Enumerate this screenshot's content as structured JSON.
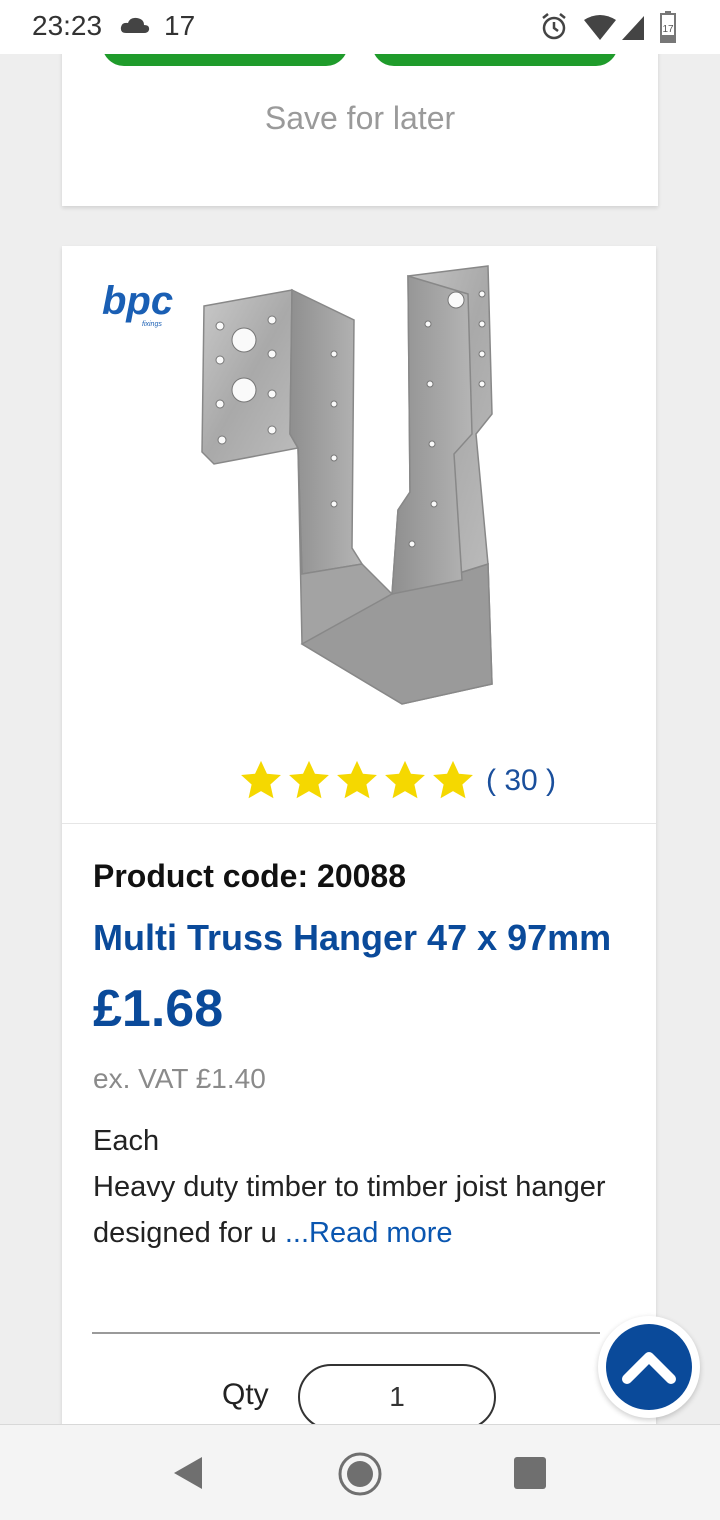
{
  "status_bar": {
    "time": "23:23",
    "temperature": "17",
    "battery_level": "17",
    "icons": [
      "cloud-icon",
      "alarm-icon",
      "wifi-icon",
      "signal-icon",
      "battery-icon"
    ]
  },
  "saved_card": {
    "save_for_later_label": "Save for later"
  },
  "product": {
    "brand": "bpc",
    "brand_sub": "fixings",
    "rating_stars": 5,
    "rating_count": "( 30 )",
    "code_label": "Product code: 20088",
    "name": "Multi Truss Hanger 47 x 97mm",
    "price": "£1.68",
    "ex_vat": "ex. VAT £1.40",
    "unit": "Each",
    "description": "Heavy duty timber to timber joist hanger designed for u",
    "read_more_label": "...Read more",
    "qty_label": "Qty",
    "qty_value": "1"
  },
  "colors": {
    "brand_blue": "#0a4a9a",
    "link_blue": "#0a56b0",
    "green": "#1f9b2b",
    "star": "#f5d800"
  }
}
